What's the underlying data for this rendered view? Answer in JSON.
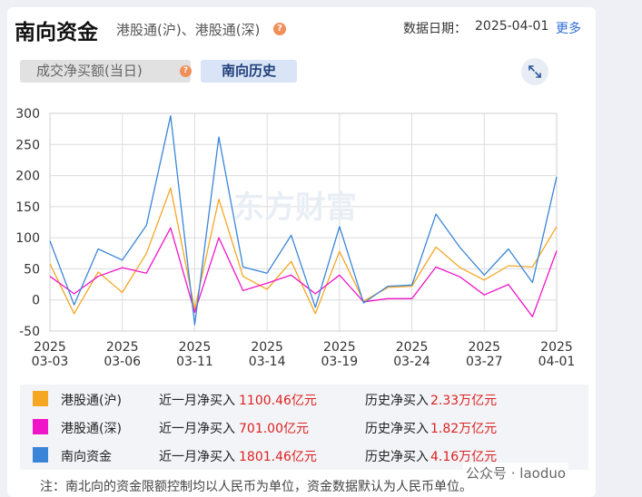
{
  "header": {
    "title": "南向资金",
    "subtitle": "港股通(沪)、港股通(深)",
    "date_label": "数据日期：",
    "date_value": "2025-04-01",
    "more_label": "更多"
  },
  "tabs": [
    {
      "label": "成交净买额(当日)",
      "active": false
    },
    {
      "label": "南向历史",
      "active": true
    }
  ],
  "watermark": "东方财富",
  "attribution": "公众号 · laoduo",
  "chart_data": {
    "type": "line",
    "x": [
      "03-03",
      "03-04",
      "03-05",
      "03-06",
      "03-07",
      "03-10",
      "03-11",
      "03-12",
      "03-13",
      "03-14",
      "03-17",
      "03-18",
      "03-19",
      "03-20",
      "03-21",
      "03-24",
      "03-25",
      "03-26",
      "03-27",
      "03-28",
      "03-31",
      "04-01"
    ],
    "tick_labels": [
      {
        "year": "2025",
        "date": "03-03",
        "index": 0
      },
      {
        "year": "2025",
        "date": "03-06",
        "index": 3
      },
      {
        "year": "2025",
        "date": "03-11",
        "index": 6
      },
      {
        "year": "2025",
        "date": "03-14",
        "index": 9
      },
      {
        "year": "2025",
        "date": "03-19",
        "index": 12
      },
      {
        "year": "2025",
        "date": "03-24",
        "index": 15
      },
      {
        "year": "2025",
        "date": "03-27",
        "index": 18
      },
      {
        "year": "2025",
        "date": "04-01",
        "index": 21
      }
    ],
    "yticks": [
      300,
      250,
      200,
      150,
      100,
      50,
      0,
      -50
    ],
    "ylim": [
      -50,
      300
    ],
    "grid": true,
    "series": [
      {
        "name": "港股通(沪)",
        "color": "#f5a623",
        "values": [
          58,
          -22,
          45,
          12,
          75,
          180,
          -15,
          162,
          38,
          17,
          62,
          -22,
          78,
          -2,
          20,
          22,
          85,
          52,
          32,
          55,
          53,
          118
        ]
      },
      {
        "name": "港股通(深)",
        "color": "#f015c9",
        "values": [
          38,
          10,
          38,
          52,
          43,
          116,
          -20,
          100,
          15,
          27,
          40,
          10,
          40,
          -3,
          2,
          2,
          53,
          37,
          8,
          25,
          -27,
          79
        ]
      },
      {
        "name": "南向资金",
        "color": "#3b85d9",
        "values": [
          95,
          -8,
          82,
          64,
          120,
          296,
          -40,
          262,
          53,
          43,
          104,
          -12,
          118,
          -5,
          22,
          24,
          138,
          84,
          40,
          82,
          28,
          198
        ]
      }
    ]
  },
  "legend": [
    {
      "name": "港股通(沪)",
      "color": "#f5a623",
      "month_label": "近一月净买入",
      "month_value": "1100.46亿元",
      "hist_label": "历史净买入",
      "hist_value": "2.33万亿元"
    },
    {
      "name": "港股通(深)",
      "color": "#f015c9",
      "month_label": "近一月净买入",
      "month_value": "701.00亿元",
      "hist_label": "历史净买入",
      "hist_value": "1.82万亿元"
    },
    {
      "name": "南向资金",
      "color": "#3b85d9",
      "month_label": "近一月净买入",
      "month_value": "1801.46亿元",
      "hist_label": "历史净买入",
      "hist_value": "4.16万亿元"
    }
  ],
  "note": "注：南北向的资金限额控制均以人民币为单位，资金数据默认为人民币单位。"
}
